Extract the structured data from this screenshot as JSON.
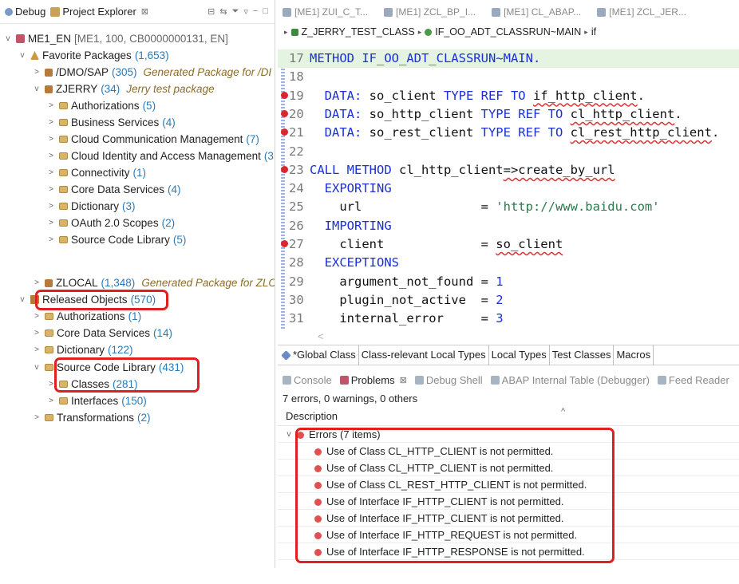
{
  "explorer": {
    "tabs": [
      {
        "label": "Debug"
      },
      {
        "label": "Project Explorer",
        "close": "⊠"
      }
    ],
    "project": {
      "label": "ME1_EN",
      "detail": "[ME1, 100, CB0000000131, EN]"
    },
    "favorites": {
      "label": "Favorite Packages",
      "count": "(1,653)"
    },
    "dmo": {
      "label": "/DMO/SAP",
      "count": "(305)",
      "note": "Generated Package for /DI"
    },
    "zjerry": {
      "label": "ZJERRY",
      "count": "(34)",
      "note": "Jerry test package"
    },
    "zjerry_items": [
      {
        "label": "Authorizations",
        "count": "(5)"
      },
      {
        "label": "Business Services",
        "count": "(4)"
      },
      {
        "label": "Cloud Communication Management",
        "count": "(7)"
      },
      {
        "label": "Cloud Identity and Access Management",
        "count": "(3"
      },
      {
        "label": "Connectivity",
        "count": "(1)"
      },
      {
        "label": "Core Data Services",
        "count": "(4)"
      },
      {
        "label": "Dictionary",
        "count": "(3)"
      },
      {
        "label": "OAuth 2.0 Scopes",
        "count": "(2)"
      },
      {
        "label": "Source Code Library",
        "count": "(5)"
      }
    ],
    "zlocal": {
      "label": "ZLOCAL",
      "count": "(1,348)",
      "note": "Generated Package for ZLOC"
    },
    "released": {
      "label": "Released Objects",
      "count": "(570)"
    },
    "released_items": [
      {
        "label": "Authorizations",
        "count": "(1)"
      },
      {
        "label": "Core Data Services",
        "count": "(14)"
      },
      {
        "label": "Dictionary",
        "count": "(122)"
      }
    ],
    "scl": {
      "label": "Source Code Library",
      "count": "(431)"
    },
    "classes": {
      "label": "Classes",
      "count": "(281)"
    },
    "interfaces": {
      "label": "Interfaces",
      "count": "(150)"
    },
    "transformations": {
      "label": "Transformations",
      "count": "(2)"
    }
  },
  "editor": {
    "tabs": [
      "[ME1] ZUI_C_T...",
      "[ME1] ZCL_BP_I...",
      "[ME1] CL_ABAP...",
      "[ME1] ZCL_JER..."
    ],
    "breadcrumb": [
      "Z_JERRY_TEST_CLASS",
      "IF_OO_ADT_CLASSRUN~MAIN",
      "if"
    ],
    "lines": [
      {
        "n": "17",
        "parts": [
          {
            "t": "METHOD IF_OO_ADT_CLASSRUN~MAIN.",
            "c": "kw"
          }
        ],
        "cur": true
      },
      {
        "n": "18",
        "parts": []
      },
      {
        "n": "19",
        "err": true,
        "parts": [
          {
            "t": "  DATA: ",
            "c": "kw"
          },
          {
            "t": "so_client ",
            "c": "tx"
          },
          {
            "t": "TYPE REF TO ",
            "c": "kw"
          },
          {
            "t": "if_http_client",
            "c": "tx wav"
          },
          {
            "t": ".",
            "c": "tx"
          }
        ]
      },
      {
        "n": "20",
        "err": true,
        "parts": [
          {
            "t": "  DATA: ",
            "c": "kw"
          },
          {
            "t": "so_http_client ",
            "c": "tx"
          },
          {
            "t": "TYPE REF TO ",
            "c": "kw"
          },
          {
            "t": "cl_http_client",
            "c": "tx wav"
          },
          {
            "t": ".",
            "c": "tx"
          }
        ]
      },
      {
        "n": "21",
        "err": true,
        "parts": [
          {
            "t": "  DATA: ",
            "c": "kw"
          },
          {
            "t": "so_rest_client ",
            "c": "tx"
          },
          {
            "t": "TYPE REF TO ",
            "c": "kw"
          },
          {
            "t": "cl_rest_http_client",
            "c": "tx wav"
          },
          {
            "t": ".",
            "c": "tx"
          }
        ]
      },
      {
        "n": "22",
        "parts": []
      },
      {
        "n": "23",
        "err": true,
        "parts": [
          {
            "t": "CALL METHOD ",
            "c": "kw"
          },
          {
            "t": "cl_http_client",
            "c": "tx"
          },
          {
            "t": "=>create_by_url",
            "c": "tx wav"
          }
        ]
      },
      {
        "n": "24",
        "parts": [
          {
            "t": "  EXPORTING",
            "c": "kw"
          }
        ]
      },
      {
        "n": "25",
        "parts": [
          {
            "t": "    url                = ",
            "c": "tx"
          },
          {
            "t": "'http://www.baidu.com'",
            "c": "str"
          }
        ]
      },
      {
        "n": "26",
        "parts": [
          {
            "t": "  IMPORTING",
            "c": "kw"
          }
        ]
      },
      {
        "n": "27",
        "err": true,
        "parts": [
          {
            "t": "    client             = ",
            "c": "tx"
          },
          {
            "t": "so_client",
            "c": "tx wav"
          }
        ]
      },
      {
        "n": "28",
        "parts": [
          {
            "t": "  EXCEPTIONS",
            "c": "kw"
          }
        ]
      },
      {
        "n": "29",
        "parts": [
          {
            "t": "    argument_not_found = ",
            "c": "tx"
          },
          {
            "t": "1",
            "c": "num"
          }
        ]
      },
      {
        "n": "30",
        "parts": [
          {
            "t": "    plugin_not_active  = ",
            "c": "tx"
          },
          {
            "t": "2",
            "c": "num"
          }
        ]
      },
      {
        "n": "31",
        "parts": [
          {
            "t": "    internal_error     = ",
            "c": "tx"
          },
          {
            "t": "3",
            "c": "num"
          }
        ]
      }
    ],
    "scroll_left": "<",
    "bottom_tabs": [
      "*Global Class",
      "Class-relevant Local Types",
      "Local Types",
      "Test Classes",
      "Macros"
    ]
  },
  "problems": {
    "views": [
      {
        "label": "Console"
      },
      {
        "label": "Problems",
        "active": true,
        "close": "⊠"
      },
      {
        "label": "Debug Shell"
      },
      {
        "label": "ABAP Internal Table (Debugger)"
      },
      {
        "label": "Feed Reader"
      }
    ],
    "summary": "7 errors, 0 warnings, 0 others",
    "column": "Description",
    "group": "Errors (7 items)",
    "errors": [
      "Use of Class CL_HTTP_CLIENT is not permitted.",
      "Use of Class CL_HTTP_CLIENT is not permitted.",
      "Use of Class CL_REST_HTTP_CLIENT is not permitted.",
      "Use of Interface IF_HTTP_CLIENT is not permitted.",
      "Use of Interface IF_HTTP_CLIENT is not permitted.",
      "Use of Interface IF_HTTP_REQUEST is not permitted.",
      "Use of Interface IF_HTTP_RESPONSE is not permitted."
    ]
  },
  "colors": {
    "highlight": "#e02020",
    "keyword": "#1a2fd6",
    "count": "#2a7ab8",
    "current_line": "#e4f4e0"
  }
}
